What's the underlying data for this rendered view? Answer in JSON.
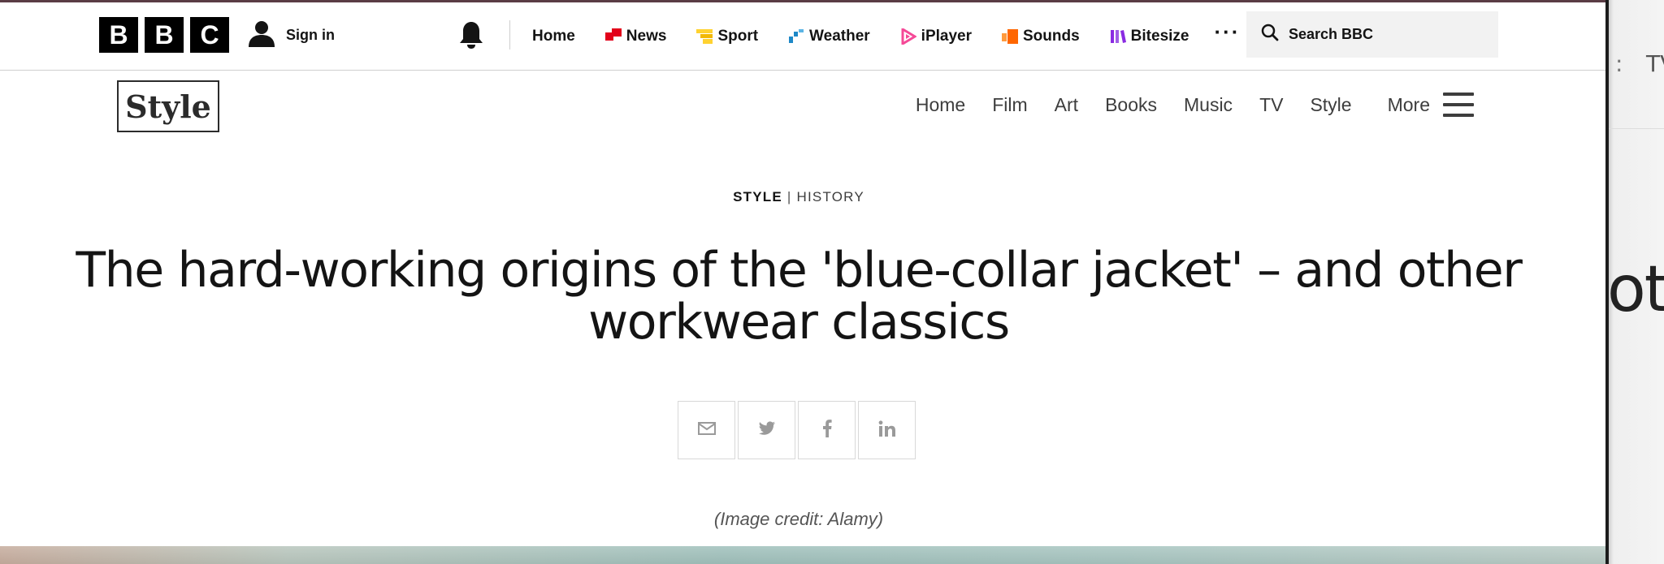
{
  "global_nav": {
    "logo_letters": [
      "B",
      "B",
      "C"
    ],
    "sign_in": "Sign in",
    "links": [
      {
        "label": "Home",
        "icon": "none",
        "color": ""
      },
      {
        "label": "News",
        "icon": "news-icon",
        "color": "#e2001a"
      },
      {
        "label": "Sport",
        "icon": "sport-icon",
        "color": "#ffd230"
      },
      {
        "label": "Weather",
        "icon": "weather-icon",
        "color": "#1e88c7"
      },
      {
        "label": "iPlayer",
        "icon": "iplayer-icon",
        "color": "#f54997"
      },
      {
        "label": "Sounds",
        "icon": "sounds-icon",
        "color": "#ff6600"
      },
      {
        "label": "Bitesize",
        "icon": "bitesize-icon",
        "color": "#8a2be2"
      }
    ],
    "more": "···",
    "search_label": "Search BBC"
  },
  "section_nav": {
    "logo": "Style",
    "links": [
      "Home",
      "Film",
      "Art",
      "Books",
      "Music",
      "TV",
      "Style"
    ],
    "more": "More"
  },
  "article": {
    "kicker_section": "STYLE",
    "kicker_separator": "|",
    "kicker_sub": "HISTORY",
    "headline": "The hard-working origins of the 'blue-collar jacket' – and other workwear classics",
    "share_buttons": [
      "email-icon",
      "twitter-icon",
      "facebook-icon",
      "linkedin-icon"
    ],
    "image_credit": "(Image credit: Alamy)"
  },
  "background_window": {
    "nav_fragment_left": ":",
    "nav_fragment_right": "TV",
    "headline_fragment": "ot"
  }
}
